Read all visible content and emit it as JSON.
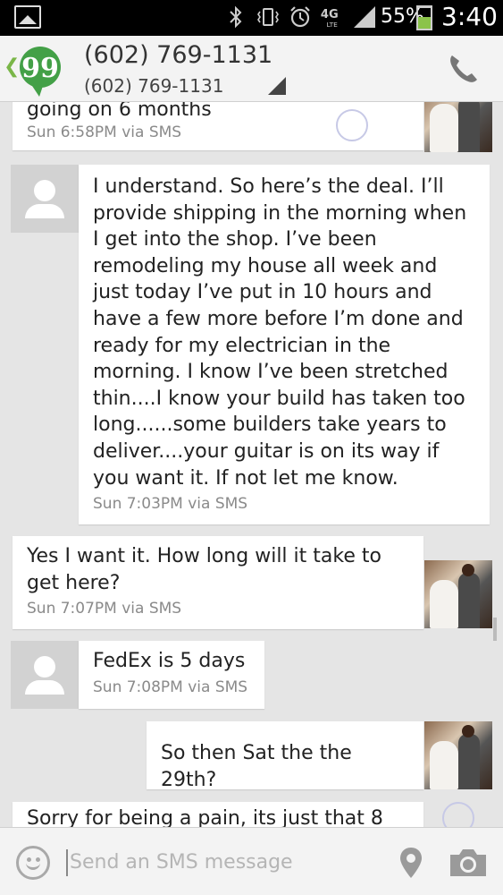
{
  "status_bar": {
    "battery_pct": "55%",
    "battery_level": 0.55,
    "time": "3:40",
    "network": "4G LTE",
    "icons": [
      "gallery-icon",
      "bluetooth-icon",
      "vibrate-icon",
      "alarm-icon",
      "4g-lte-icon",
      "signal-icon",
      "battery-icon"
    ]
  },
  "header": {
    "contact_name": "(602) 769-1131",
    "contact_number": "(602) 769-1131",
    "app_logo_text": "99",
    "accent": "#43a047"
  },
  "messages": [
    {
      "direction": "outgoing",
      "text": "going on 6 months",
      "meta": "Sun 6:58PM via SMS"
    },
    {
      "direction": "incoming",
      "text": "I understand. So here’s the deal. I’ll provide shipping in the morning when I get into the shop. I’ve been remodeling my house all week and just today I’ve put in 10 hours and have a few more before I’m done and ready for my electrician in the morning. I know I’ve been stretched thin....I know your build has taken too long......some builders take years to deliver....your guitar is on its way if you want it. If not let me know.",
      "meta": "Sun 7:03PM via SMS"
    },
    {
      "direction": "outgoing",
      "text": "Yes I want it. How long will it take to get here?",
      "meta": "Sun 7:07PM via SMS"
    },
    {
      "direction": "incoming",
      "text": "FedEx is 5 days",
      "meta": "Sun 7:08PM via SMS"
    },
    {
      "direction": "outgoing",
      "text": "So then Sat the the 29th?",
      "meta": ""
    },
    {
      "direction": "outgoing",
      "text": "Sorry for being a pain, its just that 8",
      "meta": ""
    }
  ],
  "compose": {
    "placeholder": "Send an SMS message"
  }
}
